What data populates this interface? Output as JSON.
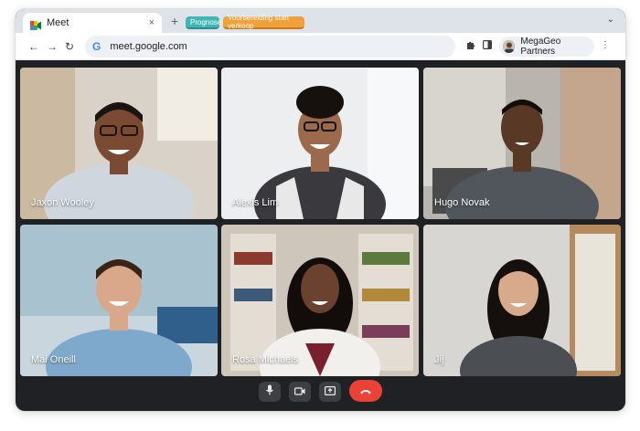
{
  "browser": {
    "tab": {
      "title": "Meet",
      "close": "×"
    },
    "new_tab": "+",
    "tab_groups": [
      {
        "label": "Prognose",
        "color": "#3fb5b5"
      },
      {
        "label": "Voorbereiding start verkoop",
        "color": "#f0a13a"
      }
    ],
    "tab_menu": "⌄",
    "nav": {
      "back": "←",
      "forward": "→",
      "reload": "↻"
    },
    "omnibox": {
      "logo": "G",
      "url": "meet.google.com"
    },
    "extensions_icon": "puzzle-icon",
    "sidebar_icon": "side-panel-icon",
    "profile": {
      "name": "MegaGeo Partners"
    },
    "menu_icon": "⋮"
  },
  "meeting": {
    "participants": [
      {
        "name": "Jaxon Wooley",
        "bg": "#d9d2c8",
        "skin": "#7a4a32",
        "shirt": "#cfd6de",
        "hair": "#1b1411"
      },
      {
        "name": "Alexis Lim",
        "bg": "#eceef0",
        "skin": "#9b6a4c",
        "shirt": "#3a3a3e",
        "hair": "#17110e"
      },
      {
        "name": "Hugo Novak",
        "bg": "#b9b4ad",
        "skin": "#5a3826",
        "shirt": "#51565c",
        "hair": "#120d0b"
      },
      {
        "name": "Mai Oneill",
        "bg": "#a9c2d0",
        "skin": "#d9a88b",
        "shirt": "#7fa9cc",
        "hair": "#3a2418"
      },
      {
        "name": "Rosa Michaels",
        "bg": "#cfc6bb",
        "skin": "#6b4130",
        "shirt": "#f2f0ed",
        "hair": "#120c0a"
      },
      {
        "name": "Jij",
        "bg": "#d7d6d3",
        "skin": "#d6aa8a",
        "shirt": "#4b4f54",
        "hair": "#15100e"
      }
    ],
    "controls": [
      {
        "name": "microphone",
        "icon": "microphone-icon"
      },
      {
        "name": "camera",
        "icon": "camera-icon"
      },
      {
        "name": "present",
        "icon": "present-screen-icon"
      },
      {
        "name": "leave",
        "icon": "hang-up-icon",
        "color": "#ea4335"
      }
    ]
  }
}
